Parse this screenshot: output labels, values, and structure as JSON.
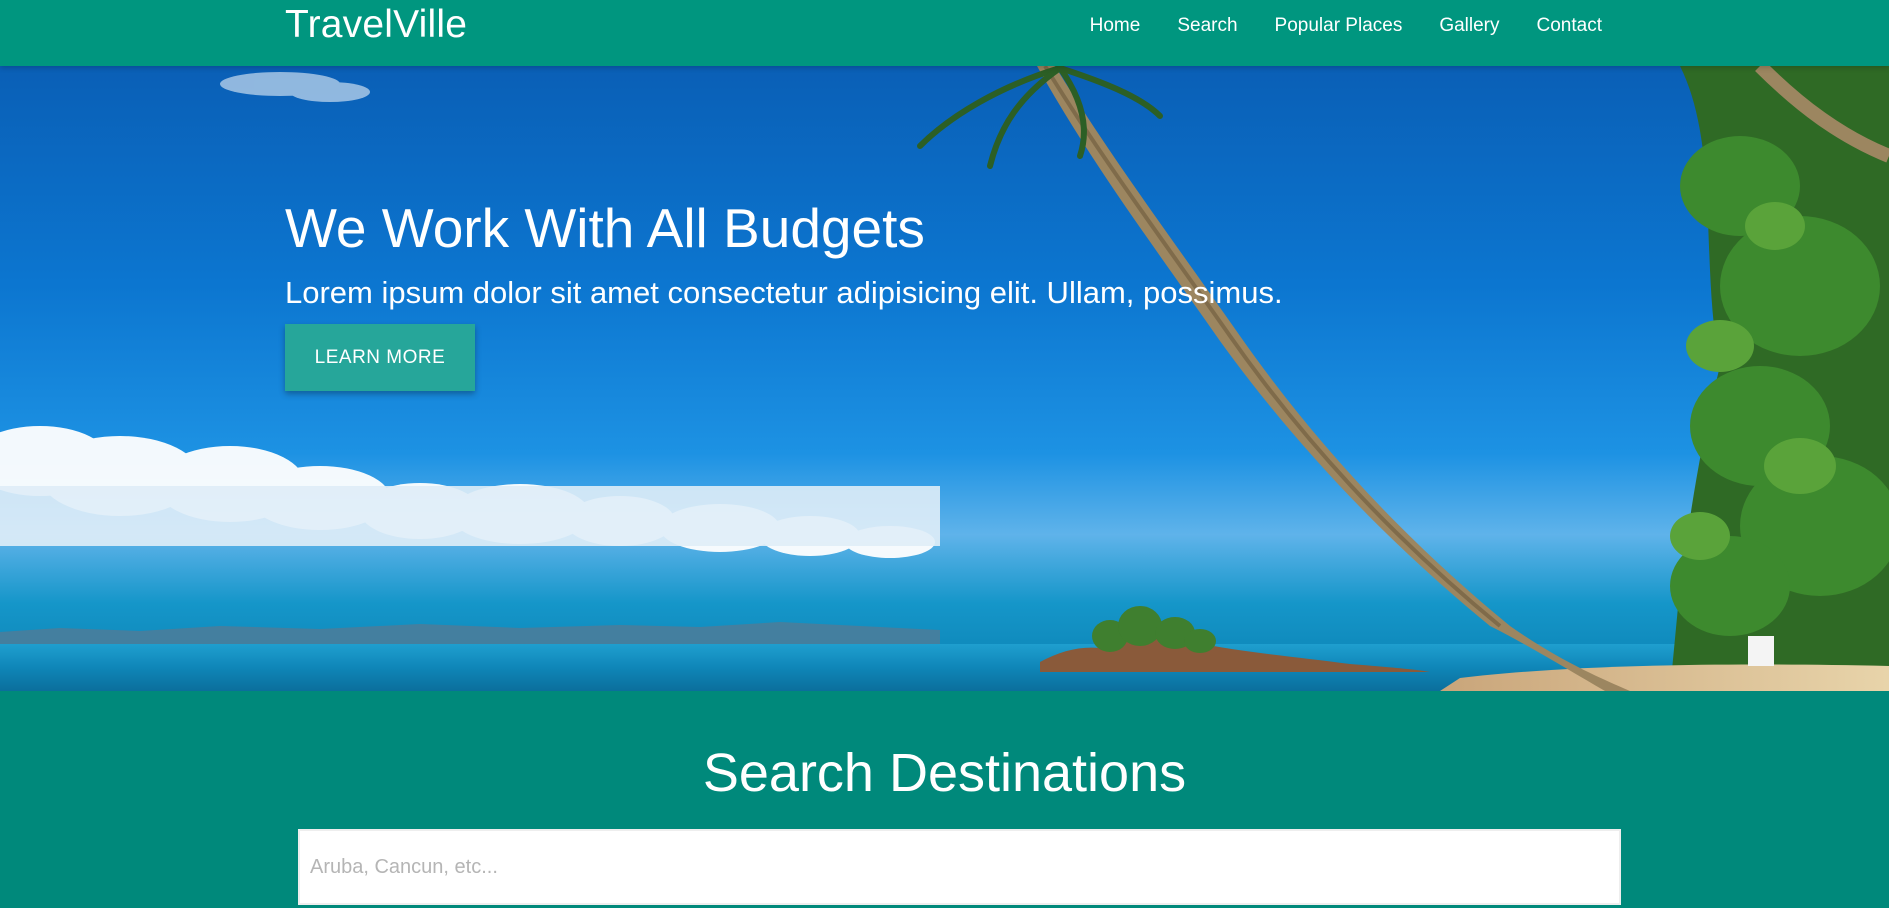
{
  "brand": "TravelVille",
  "nav": {
    "items": [
      {
        "label": "Home"
      },
      {
        "label": "Search"
      },
      {
        "label": "Popular Places"
      },
      {
        "label": "Gallery"
      },
      {
        "label": "Contact"
      }
    ]
  },
  "hero": {
    "title": "We Work With All Budgets",
    "text": "Lorem ipsum dolor sit amet consectetur adipisicing elit. Ullam, possimus.",
    "button_label": "LEARN MORE"
  },
  "search": {
    "title": "Search Destinations",
    "placeholder": "Aruba, Cancun, etc..."
  },
  "colors": {
    "navbar": "#00967f",
    "section": "#00897b",
    "button": "#26a69a"
  }
}
